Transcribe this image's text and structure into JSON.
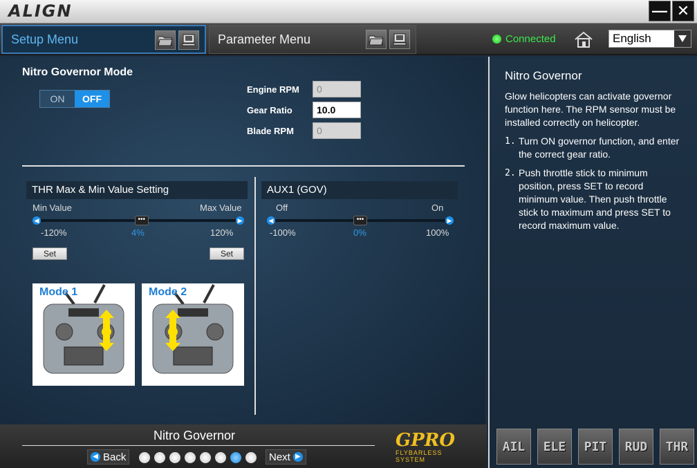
{
  "app": {
    "logo": "ALIGN"
  },
  "window": {
    "minimize": "—",
    "close": "✕"
  },
  "menu": {
    "tabs": [
      {
        "label": "Setup Menu",
        "active": true
      },
      {
        "label": "Parameter Menu",
        "active": false
      }
    ],
    "status": "Connected",
    "language": "English"
  },
  "governor": {
    "title": "Nitro Governor Mode",
    "toggle_on": "ON",
    "toggle_off": "OFF",
    "selected": "OFF",
    "engine_rpm_label": "Engine RPM",
    "engine_rpm_value": "0",
    "gear_ratio_label": "Gear Ratio",
    "gear_ratio_value": "10.0",
    "blade_rpm_label": "Blade RPM",
    "blade_rpm_value": "0"
  },
  "thr": {
    "title": "THR Max & Min Value Setting",
    "min_label": "Min Value",
    "max_label": "Max Value",
    "left_value": "-120%",
    "current_value": "4%",
    "right_value": "120%",
    "position": 4,
    "set_left": "Set",
    "set_right": "Set",
    "mode1": "Mode 1",
    "mode2": "Mode 2"
  },
  "aux": {
    "title": "AUX1 (GOV)",
    "off_label": "Off",
    "on_label": "On",
    "left_value": "-100%",
    "current_value": "0%",
    "right_value": "100%",
    "position": 0
  },
  "help": {
    "title": "Nitro Governor",
    "intro": "Glow helicopters can activate governor function here.  The RPM sensor must be installed correctly on helicopter.",
    "steps": [
      {
        "num": "1.",
        "text": "Turn ON governor function, and enter the correct gear ratio."
      },
      {
        "num": "2.",
        "text": "Push throttle stick to minimum position, press SET to record minimum value.  Then push throttle stick to maximum and press SET to record maximum value."
      }
    ]
  },
  "footer": {
    "page_title": "Nitro Governor",
    "back": "Back",
    "next": "Next",
    "page_count": 8,
    "current_page": 7,
    "brand": "GPRO",
    "brand_sub": "FLYBARLESS SYSTEM"
  },
  "channels": [
    "AIL",
    "ELE",
    "PIT",
    "RUD",
    "THR"
  ],
  "colors": {
    "accent": "#1e90e8",
    "connected": "#3ce84a",
    "brand": "#f0c020"
  }
}
